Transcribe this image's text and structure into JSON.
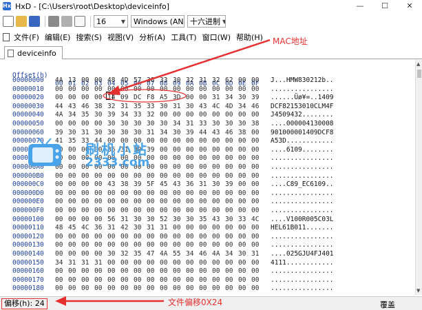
{
  "window": {
    "title": "HxD - [C:\\Users\\root\\Desktop\\deviceinfo]",
    "app_icon": "HxD",
    "controls": [
      "—",
      "☐",
      "✕"
    ]
  },
  "toolbar": {
    "icons": [
      "new-file-icon",
      "open-folder-icon",
      "save-icon",
      "tools-icon",
      "copy-icon",
      "page-icon"
    ],
    "bytes_per_row": "16",
    "charset": "Windows (AN",
    "offset_base": "十六进制"
  },
  "menu": [
    "文件(F)",
    "编辑(E)",
    "搜索(S)",
    "视图(V)",
    "分析(A)",
    "工具(T)",
    "窗口(W)",
    "帮助(H)"
  ],
  "tab": {
    "label": "deviceinfo"
  },
  "hex": {
    "header_offset": "Offset(h)",
    "header_cols": [
      "00",
      "01",
      "02",
      "03",
      "04",
      "05",
      "06",
      "07",
      "08",
      "09",
      "0A",
      "0B",
      "0C",
      "0D",
      "0E",
      "0F"
    ],
    "rows": [
      {
        "offset": "00000000",
        "bytes": [
          "4A",
          "13",
          "00",
          "00",
          "48",
          "4D",
          "57",
          "38",
          "33",
          "30",
          "32",
          "31",
          "32",
          "62",
          "00",
          "00"
        ],
        "ascii": "J...HMW830212b.."
      },
      {
        "offset": "00000010",
        "bytes": [
          "00",
          "00",
          "00",
          "00",
          "00",
          "00",
          "00",
          "00",
          "00",
          "00",
          "00",
          "00",
          "00",
          "00",
          "00",
          "00"
        ],
        "ascii": "................"
      },
      {
        "offset": "00000020",
        "bytes": [
          "00",
          "00",
          "00",
          "00",
          "14",
          "09",
          "DC",
          "F8",
          "A5",
          "3D",
          "00",
          "00",
          "31",
          "34",
          "30",
          "39"
        ],
        "ascii": "......Üø¥=..1409"
      },
      {
        "offset": "00000030",
        "bytes": [
          "44",
          "43",
          "46",
          "38",
          "32",
          "31",
          "35",
          "33",
          "30",
          "31",
          "30",
          "43",
          "4C",
          "4D",
          "34",
          "46"
        ],
        "ascii": "DCF82153010CLM4F"
      },
      {
        "offset": "00000040",
        "bytes": [
          "4A",
          "34",
          "35",
          "30",
          "39",
          "34",
          "33",
          "32",
          "00",
          "00",
          "00",
          "00",
          "00",
          "00",
          "00",
          "00"
        ],
        "ascii": "J4509432........"
      },
      {
        "offset": "00000050",
        "bytes": [
          "00",
          "00",
          "00",
          "00",
          "30",
          "30",
          "30",
          "30",
          "30",
          "34",
          "31",
          "33",
          "30",
          "30",
          "30",
          "38"
        ],
        "ascii": "....000004130008"
      },
      {
        "offset": "00000060",
        "bytes": [
          "39",
          "30",
          "31",
          "30",
          "30",
          "30",
          "30",
          "31",
          "34",
          "30",
          "39",
          "44",
          "43",
          "46",
          "38",
          "00"
        ],
        "ascii": "901000001409DCF8"
      },
      {
        "offset": "00000070",
        "bytes": [
          "41",
          "35",
          "33",
          "44",
          "00",
          "00",
          "00",
          "00",
          "00",
          "00",
          "00",
          "00",
          "00",
          "00",
          "00",
          "00"
        ],
        "ascii": "A53D............"
      },
      {
        "offset": "00000080",
        "bytes": [
          "00",
          "00",
          "00",
          "00",
          "36",
          "31",
          "30",
          "39",
          "00",
          "00",
          "00",
          "00",
          "00",
          "00",
          "00",
          "00"
        ],
        "ascii": "....6109........"
      },
      {
        "offset": "00000090",
        "bytes": [
          "00",
          "00",
          "00",
          "00",
          "00",
          "00",
          "00",
          "00",
          "00",
          "00",
          "00",
          "00",
          "00",
          "00",
          "00",
          "00"
        ],
        "ascii": "................"
      },
      {
        "offset": "000000A0",
        "bytes": [
          "00",
          "00",
          "00",
          "00",
          "00",
          "00",
          "00",
          "00",
          "00",
          "00",
          "00",
          "00",
          "00",
          "00",
          "00",
          "00"
        ],
        "ascii": "................"
      },
      {
        "offset": "000000B0",
        "bytes": [
          "00",
          "00",
          "00",
          "00",
          "00",
          "00",
          "00",
          "00",
          "00",
          "00",
          "00",
          "00",
          "00",
          "00",
          "00",
          "00"
        ],
        "ascii": "................"
      },
      {
        "offset": "000000C0",
        "bytes": [
          "00",
          "00",
          "00",
          "00",
          "43",
          "38",
          "39",
          "5F",
          "45",
          "43",
          "36",
          "31",
          "30",
          "39",
          "00",
          "00"
        ],
        "ascii": "....C89_EC6109.."
      },
      {
        "offset": "000000D0",
        "bytes": [
          "00",
          "00",
          "00",
          "00",
          "00",
          "00",
          "00",
          "00",
          "00",
          "00",
          "00",
          "00",
          "00",
          "00",
          "00",
          "00"
        ],
        "ascii": "................"
      },
      {
        "offset": "000000E0",
        "bytes": [
          "00",
          "00",
          "00",
          "00",
          "00",
          "00",
          "00",
          "00",
          "00",
          "00",
          "00",
          "00",
          "00",
          "00",
          "00",
          "00"
        ],
        "ascii": "................"
      },
      {
        "offset": "000000F0",
        "bytes": [
          "00",
          "00",
          "00",
          "00",
          "00",
          "00",
          "00",
          "00",
          "00",
          "00",
          "00",
          "00",
          "00",
          "00",
          "00",
          "00"
        ],
        "ascii": "................"
      },
      {
        "offset": "00000100",
        "bytes": [
          "00",
          "00",
          "00",
          "00",
          "56",
          "31",
          "30",
          "30",
          "52",
          "30",
          "30",
          "35",
          "43",
          "30",
          "33",
          "4C"
        ],
        "ascii": "....V100R005C03L"
      },
      {
        "offset": "00000110",
        "bytes": [
          "48",
          "45",
          "4C",
          "36",
          "31",
          "42",
          "30",
          "31",
          "31",
          "00",
          "00",
          "00",
          "00",
          "00",
          "00",
          "00"
        ],
        "ascii": "HEL61B011......."
      },
      {
        "offset": "00000120",
        "bytes": [
          "00",
          "00",
          "00",
          "00",
          "00",
          "00",
          "00",
          "00",
          "00",
          "00",
          "00",
          "00",
          "00",
          "00",
          "00",
          "00"
        ],
        "ascii": "................"
      },
      {
        "offset": "00000130",
        "bytes": [
          "00",
          "00",
          "00",
          "00",
          "00",
          "00",
          "00",
          "00",
          "00",
          "00",
          "00",
          "00",
          "00",
          "00",
          "00",
          "00"
        ],
        "ascii": "................"
      },
      {
        "offset": "00000140",
        "bytes": [
          "00",
          "00",
          "00",
          "00",
          "30",
          "32",
          "35",
          "47",
          "4A",
          "55",
          "34",
          "46",
          "4A",
          "34",
          "30",
          "31"
        ],
        "ascii": "....025GJU4FJ401"
      },
      {
        "offset": "00000150",
        "bytes": [
          "34",
          "31",
          "31",
          "31",
          "00",
          "00",
          "00",
          "00",
          "00",
          "00",
          "00",
          "00",
          "00",
          "00",
          "00",
          "00"
        ],
        "ascii": "4111............"
      },
      {
        "offset": "00000160",
        "bytes": [
          "00",
          "00",
          "00",
          "00",
          "00",
          "00",
          "00",
          "00",
          "00",
          "00",
          "00",
          "00",
          "00",
          "00",
          "00",
          "00"
        ],
        "ascii": "................"
      },
      {
        "offset": "00000170",
        "bytes": [
          "00",
          "00",
          "00",
          "00",
          "00",
          "00",
          "00",
          "00",
          "00",
          "00",
          "00",
          "00",
          "00",
          "00",
          "00",
          "00"
        ],
        "ascii": "................"
      },
      {
        "offset": "00000180",
        "bytes": [
          "00",
          "00",
          "00",
          "00",
          "00",
          "00",
          "00",
          "00",
          "00",
          "00",
          "00",
          "00",
          "00",
          "00",
          "00",
          "00"
        ],
        "ascii": "................"
      }
    ]
  },
  "status": {
    "offset": "偏移(h): 24",
    "mode": "覆盖"
  },
  "annotations": {
    "mac": "MAC地址",
    "file_offset": "文件偏移0X24",
    "color": "#e53030"
  },
  "watermark": {
    "line1": "刷机小站",
    "line2": "2333.com"
  }
}
